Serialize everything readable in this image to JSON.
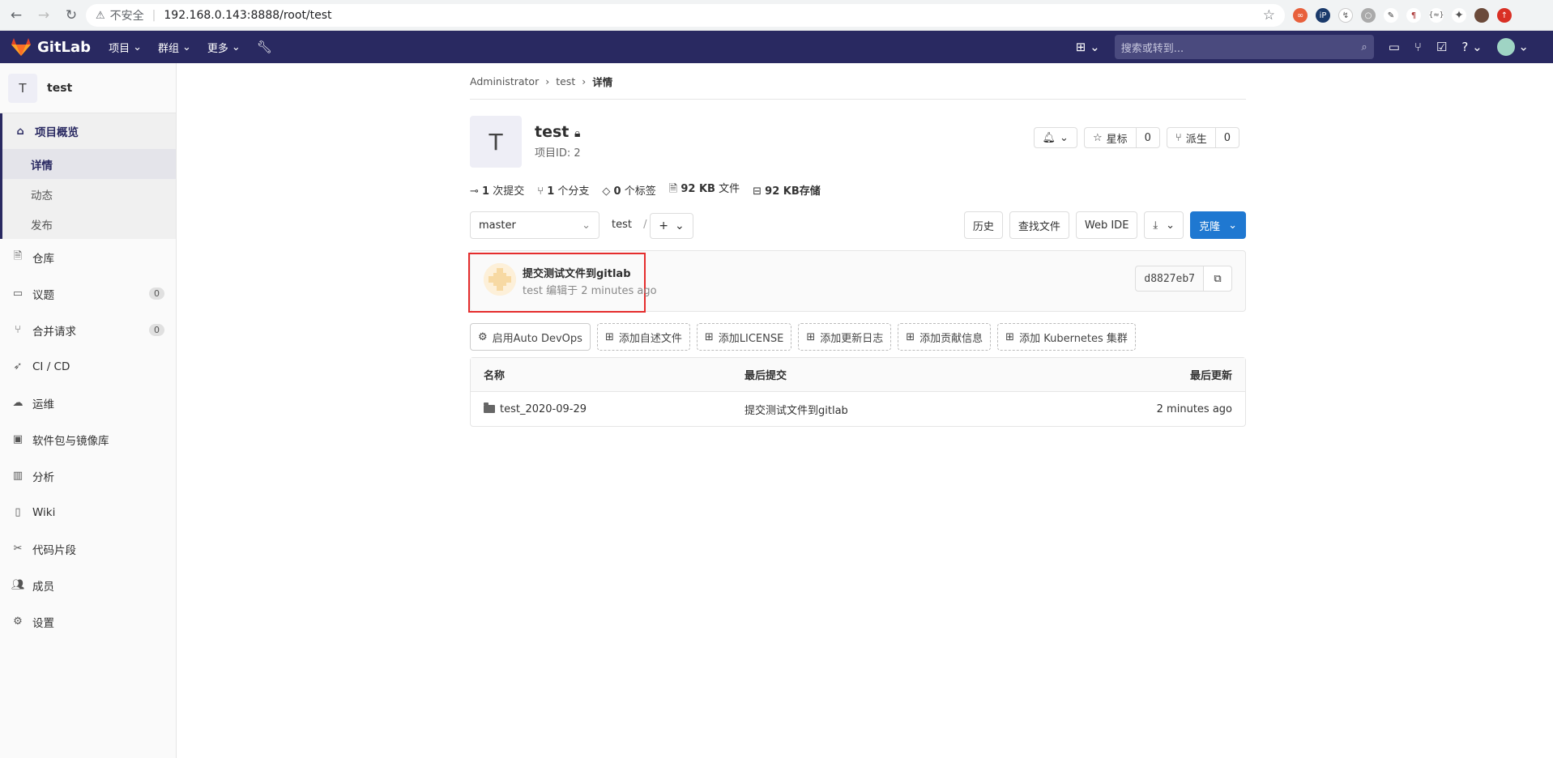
{
  "browser": {
    "security": "不安全",
    "url": "192.168.0.143:8888/root/test"
  },
  "topnav": {
    "brand": "GitLab",
    "menu": [
      "项目",
      "群组",
      "更多"
    ],
    "search_placeholder": "搜索或转到..."
  },
  "sidebar": {
    "project_initial": "T",
    "project_name": "test",
    "overview": "项目概览",
    "sub_items": [
      "详情",
      "动态",
      "发布"
    ],
    "items": [
      {
        "label": "仓库",
        "icon": "document-icon"
      },
      {
        "label": "议题",
        "icon": "issues-icon",
        "count": "0"
      },
      {
        "label": "合并请求",
        "icon": "merge-request-icon",
        "count": "0"
      },
      {
        "label": "CI / CD",
        "icon": "rocket-icon"
      },
      {
        "label": "运维",
        "icon": "cloud-icon"
      },
      {
        "label": "软件包与镜像库",
        "icon": "package-icon"
      },
      {
        "label": "分析",
        "icon": "chart-icon"
      },
      {
        "label": "Wiki",
        "icon": "book-icon"
      },
      {
        "label": "代码片段",
        "icon": "scissors-icon"
      },
      {
        "label": "成员",
        "icon": "users-icon"
      },
      {
        "label": "设置",
        "icon": "gear-icon"
      }
    ]
  },
  "breadcrumb": [
    "Administrator",
    "test",
    "详情"
  ],
  "project": {
    "initial": "T",
    "title": "test",
    "id_text": "项目ID: 2",
    "star_label": "星标",
    "star_count": "0",
    "fork_label": "派生",
    "fork_count": "0"
  },
  "stats": {
    "commits_num": "1",
    "commits_label": "次提交",
    "branches_num": "1",
    "branches_label": "个分支",
    "tags_num": "0",
    "tags_label": "个标签",
    "files_num": "92 KB",
    "files_label": "文件",
    "storage_num": "92 KB",
    "storage_label": "存储"
  },
  "toolbar": {
    "branch": "master",
    "path": "test",
    "path_sep": "/",
    "history": "历史",
    "find_file": "查找文件",
    "web_ide": "Web IDE",
    "clone": "克隆"
  },
  "commit": {
    "message": "提交测试文件到gitlab",
    "author": "test",
    "edited": "编辑于 2 minutes ago",
    "sha": "d8827eb7"
  },
  "shortcuts": [
    "启用Auto DevOps",
    "添加自述文件",
    "添加LICENSE",
    "添加更新日志",
    "添加贡献信息",
    "添加 Kubernetes 集群"
  ],
  "table": {
    "headers": [
      "名称",
      "最后提交",
      "最后更新"
    ],
    "rows": [
      {
        "name": "test_2020-09-29",
        "commit": "提交测试文件到gitlab",
        "updated": "2 minutes ago"
      }
    ]
  }
}
